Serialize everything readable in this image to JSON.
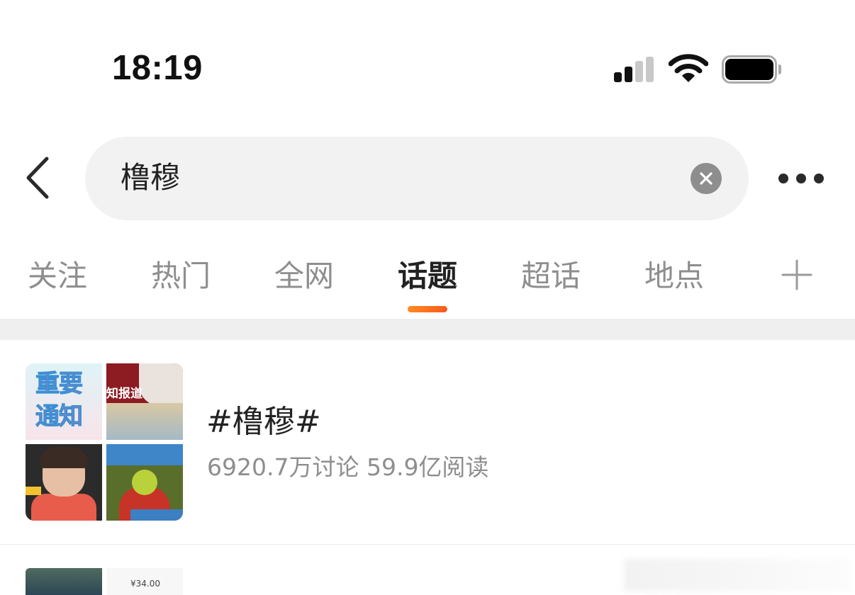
{
  "status_bar": {
    "time": "18:19"
  },
  "search": {
    "query": "橹穆"
  },
  "tabs": [
    {
      "label": "关注"
    },
    {
      "label": "热门"
    },
    {
      "label": "全网"
    },
    {
      "label": "话题"
    },
    {
      "label": "超话"
    },
    {
      "label": "地点"
    }
  ],
  "active_tab": "话题",
  "accent_color": "#f7701e",
  "topic": {
    "thumbnail_text_1": "重要",
    "thumbnail_text_2": "通知",
    "thumbnail_text_3": "知报道",
    "title": "#橹穆#",
    "stats": "6920.7万讨论 59.9亿阅读"
  },
  "next_item": {
    "price": "¥34.00"
  }
}
